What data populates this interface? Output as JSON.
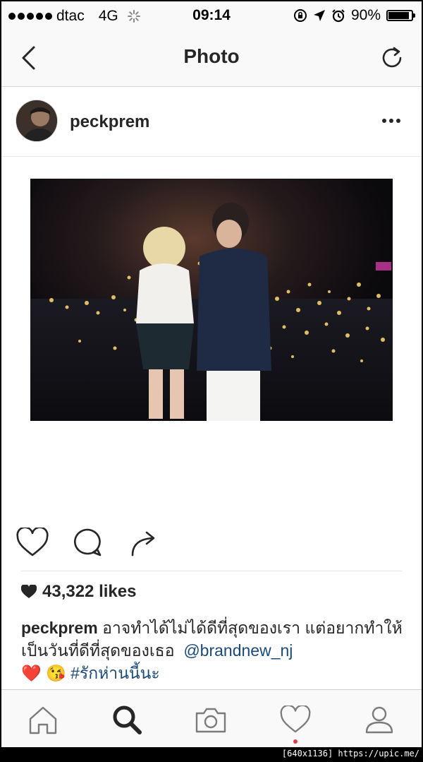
{
  "status_bar": {
    "carrier": "dtac",
    "network": "4G",
    "time": "09:14",
    "battery": "90%",
    "battery_level": 0.9
  },
  "navbar": {
    "title": "Photo",
    "back_icon": "chevron-left-icon",
    "refresh_icon": "refresh-icon"
  },
  "post": {
    "username": "peckprem",
    "likes": "43,322 likes",
    "caption": {
      "username": "peckprem",
      "text": "อาจทำได้ไม่ได้ดีที่สุดของเรา แต่อยากทำให้เป็นวันที่ดีที่สุดของเธอ",
      "mention": "@brandnew_nj",
      "emojis": "❤️ 😘",
      "hashtag": "#รักห่านนี้นะ"
    }
  },
  "tabbar": {
    "items": [
      "home-icon",
      "search-icon",
      "camera-icon",
      "heart-icon",
      "profile-icon"
    ],
    "active": "search-icon",
    "notification_color": "#e23b4e"
  },
  "watermark": "[640x1136] https://upic.me/",
  "colors": {
    "text": "#262626",
    "link": "#1a4a7a",
    "bar_bg": "#f9f9f9"
  }
}
